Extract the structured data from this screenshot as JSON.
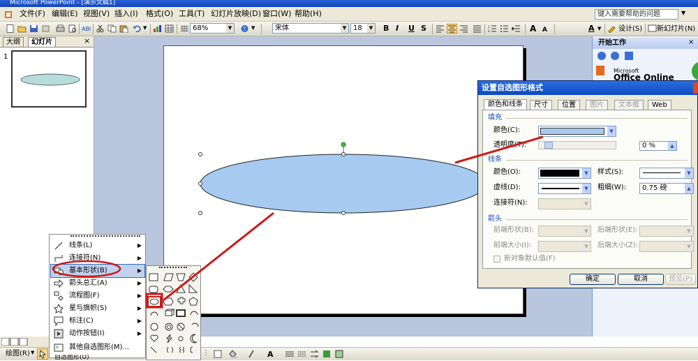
{
  "window": {
    "title": "Microsoft PowerPoint - [演示文稿1]"
  },
  "menu": {
    "items": [
      "文件(F)",
      "编辑(E)",
      "视图(V)",
      "插入(I)",
      "格式(O)",
      "工具(T)",
      "幻灯片放映(D)",
      "窗口(W)",
      "帮助(H)"
    ],
    "help_placeholder": "键入需要帮助的问题"
  },
  "toolbar": {
    "zoom": "68%",
    "font": "宋体",
    "font_size": "18",
    "bold": "B",
    "italic": "I",
    "underline": "U",
    "shadow": "S",
    "increase_font": "A",
    "decrease_font": "A",
    "design_label": "设计(S)",
    "new_slide_label": "新幻灯片(N)"
  },
  "left_pane": {
    "tabs": [
      "大纲",
      "幻灯片"
    ],
    "close_glyph": "×",
    "slide_number": "1"
  },
  "task_pane": {
    "title": "开始工作",
    "logo_small": "Microsoft",
    "logo_big": "Office Online"
  },
  "dialog": {
    "title": "设置自选图形格式",
    "tabs": [
      "颜色和线条",
      "尺寸",
      "位置",
      "图片",
      "文本框",
      "Web"
    ],
    "fill": {
      "section": "填充",
      "color_label": "颜色(C):",
      "color_value": "#a6caf0",
      "transparency_label": "透明度(T):",
      "transparency_value": "0 %"
    },
    "line": {
      "section": "线条",
      "color_label": "颜色(O):",
      "style_label": "样式(S):",
      "dashed_label": "虚线(D):",
      "weight_label": "粗细(W):",
      "weight_value": "0.75 磅",
      "connector_label": "连接符(N):"
    },
    "arrows": {
      "section": "箭头",
      "begin_style_label": "前端形状(B):",
      "end_style_label": "后端形状(E):",
      "begin_size_label": "前端大小(I):",
      "end_size_label": "后端大小(Z):"
    },
    "default_checkbox": "新对象默认值(F)",
    "ok": "确定",
    "cancel": "取消",
    "preview": "预览(P)"
  },
  "shape_menu": {
    "items": [
      {
        "label": "线条(L)",
        "icon": "line-icon"
      },
      {
        "label": "连接符(N)",
        "icon": "connector-icon"
      },
      {
        "label": "基本形状(B)",
        "icon": "basic-shapes-icon"
      },
      {
        "label": "箭头总汇(A)",
        "icon": "block-arrows-icon"
      },
      {
        "label": "流程图(F)",
        "icon": "flowchart-icon"
      },
      {
        "label": "星与旗帜(S)",
        "icon": "stars-banners-icon"
      },
      {
        "label": "标注(C)",
        "icon": "callouts-icon"
      },
      {
        "label": "动作按钮(I)",
        "icon": "action-buttons-icon"
      },
      {
        "label": "其他自选图形(M)...",
        "icon": "more-autoshapes-icon"
      }
    ]
  },
  "drawing_toolbar": {
    "draw_label": "绘图(R)",
    "autoshapes_label": "自选图形(U)"
  },
  "colors": {
    "ellipse_fill": "#a6caf0",
    "annotation_red": "#cc1a1a",
    "title_blue": "#1244b8"
  }
}
